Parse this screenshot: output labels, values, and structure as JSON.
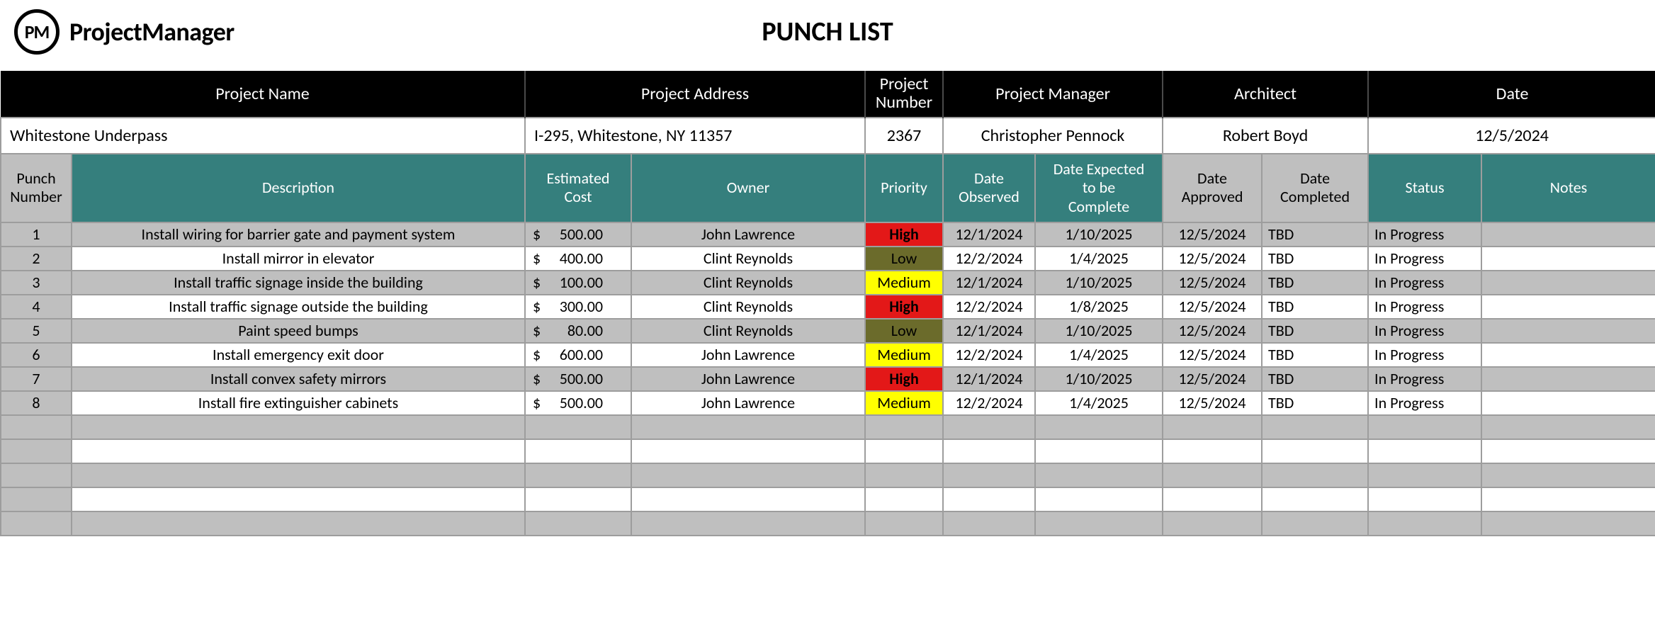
{
  "brand": {
    "logo_initials": "PM",
    "logo_text": "ProjectManager"
  },
  "title": "PUNCH LIST",
  "meta_headers": {
    "project_name": "Project Name",
    "project_address": "Project Address",
    "project_number": "Project\nNumber",
    "project_manager": "Project Manager",
    "architect": "Architect",
    "date": "Date"
  },
  "meta_values": {
    "project_name": "Whitestone Underpass",
    "project_address": "I-295, Whitestone, NY 11357",
    "project_number": "2367",
    "project_manager": "Christopher Pennock",
    "architect": "Robert Boyd",
    "date": "12/5/2024"
  },
  "col_headers": {
    "punch_number": "Punch\nNumber",
    "description": "Description",
    "estimated_cost": "Estimated\nCost",
    "owner": "Owner",
    "priority": "Priority",
    "date_observed": "Date\nObserved",
    "date_expected": "Date Expected\nto be\nComplete",
    "date_approved": "Date\nApproved",
    "date_completed": "Date\nCompleted",
    "status": "Status",
    "notes": "Notes"
  },
  "currency_symbol": "$",
  "rows": [
    {
      "num": "1",
      "desc": "Install wiring for barrier gate and payment system",
      "cost": "500.00",
      "owner": "John Lawrence",
      "priority": "High",
      "observed": "12/1/2024",
      "expected": "1/10/2025",
      "approved": "12/5/2024",
      "completed": "TBD",
      "status": "In Progress",
      "notes": ""
    },
    {
      "num": "2",
      "desc": "Install mirror in elevator",
      "cost": "400.00",
      "owner": "Clint Reynolds",
      "priority": "Low",
      "observed": "12/2/2024",
      "expected": "1/4/2025",
      "approved": "12/5/2024",
      "completed": "TBD",
      "status": "In Progress",
      "notes": ""
    },
    {
      "num": "3",
      "desc": "Install traffic signage inside the building",
      "cost": "100.00",
      "owner": "Clint Reynolds",
      "priority": "Medium",
      "observed": "12/1/2024",
      "expected": "1/10/2025",
      "approved": "12/5/2024",
      "completed": "TBD",
      "status": "In Progress",
      "notes": ""
    },
    {
      "num": "4",
      "desc": "Install traffic signage outside the building",
      "cost": "300.00",
      "owner": "Clint Reynolds",
      "priority": "High",
      "observed": "12/2/2024",
      "expected": "1/8/2025",
      "approved": "12/5/2024",
      "completed": "TBD",
      "status": "In Progress",
      "notes": ""
    },
    {
      "num": "5",
      "desc": "Paint speed bumps",
      "cost": "80.00",
      "owner": "Clint Reynolds",
      "priority": "Low",
      "observed": "12/1/2024",
      "expected": "1/10/2025",
      "approved": "12/5/2024",
      "completed": "TBD",
      "status": "In Progress",
      "notes": ""
    },
    {
      "num": "6",
      "desc": "Install emergency exit door",
      "cost": "600.00",
      "owner": "John Lawrence",
      "priority": "Medium",
      "observed": "12/2/2024",
      "expected": "1/4/2025",
      "approved": "12/5/2024",
      "completed": "TBD",
      "status": "In Progress",
      "notes": ""
    },
    {
      "num": "7",
      "desc": "Install convex safety mirrors",
      "cost": "500.00",
      "owner": "John Lawrence",
      "priority": "High",
      "observed": "12/1/2024",
      "expected": "1/10/2025",
      "approved": "12/5/2024",
      "completed": "TBD",
      "status": "In Progress",
      "notes": ""
    },
    {
      "num": "8",
      "desc": "Install fire extinguisher cabinets",
      "cost": "500.00",
      "owner": "John Lawrence",
      "priority": "Medium",
      "observed": "12/2/2024",
      "expected": "1/4/2025",
      "approved": "12/5/2024",
      "completed": "TBD",
      "status": "In Progress",
      "notes": ""
    }
  ],
  "empty_rows": 5
}
